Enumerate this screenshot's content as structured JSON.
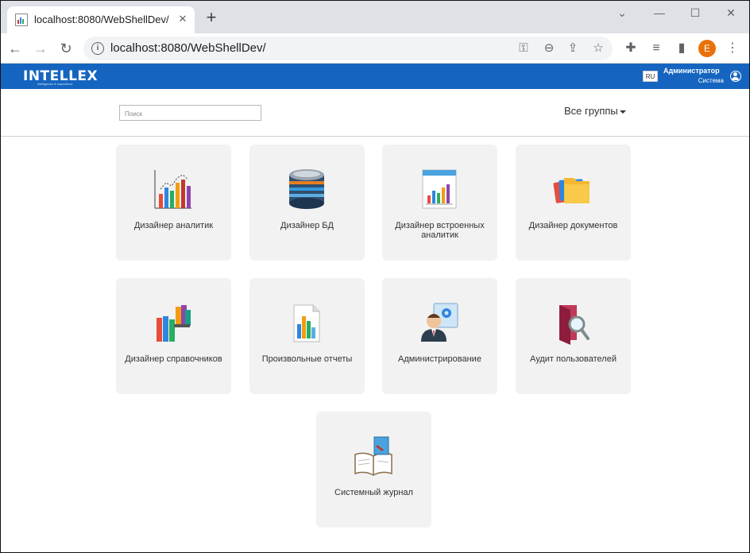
{
  "browser": {
    "tab_title": "localhost:8080/WebShellDev/",
    "tab_close": "✕",
    "new_tab": "+",
    "url": "localhost:8080/WebShellDev/",
    "profile_initial": "E",
    "window": {
      "minimize": "⌄",
      "restore": "—",
      "maximize": "☐",
      "close": "✕"
    },
    "nav": {
      "back": "←",
      "forward": "→",
      "reload": "↻"
    },
    "info": "i",
    "omni_icons": {
      "key": "⚿",
      "zoom": "⊖",
      "share": "⇪",
      "star": "☆"
    },
    "toolbar_icons": {
      "extensions": "✚",
      "media": "≡",
      "sidepanel": "▮",
      "menu": "⋮"
    }
  },
  "app": {
    "logo": "INTELLEX",
    "logo_tagline": "intelligence & experience",
    "lang": "RU",
    "user_name": "Администратор",
    "user_role": "Система",
    "accent_color": "#1565c0"
  },
  "search": {
    "placeholder": "Поиск",
    "value": ""
  },
  "groups_label": "Все группы",
  "tiles": [
    {
      "label": "Дизайнер аналитик",
      "icon": "bar-chart-icon"
    },
    {
      "label": "Дизайнер БД",
      "icon": "database-icon"
    },
    {
      "label": "Дизайнер встроенных аналитик",
      "icon": "report-chart-icon"
    },
    {
      "label": "Дизайнер документов",
      "icon": "folders-icon"
    },
    {
      "label": "Дизайнер справочников",
      "icon": "books-icon"
    },
    {
      "label": "Произвольные отчеты",
      "icon": "custom-report-icon"
    },
    {
      "label": "Администрирование",
      "icon": "admin-user-icon"
    },
    {
      "label": "Аудит пользователей",
      "icon": "audit-magnifier-icon"
    },
    {
      "label": "Системный журнал",
      "icon": "system-log-book-icon"
    }
  ]
}
